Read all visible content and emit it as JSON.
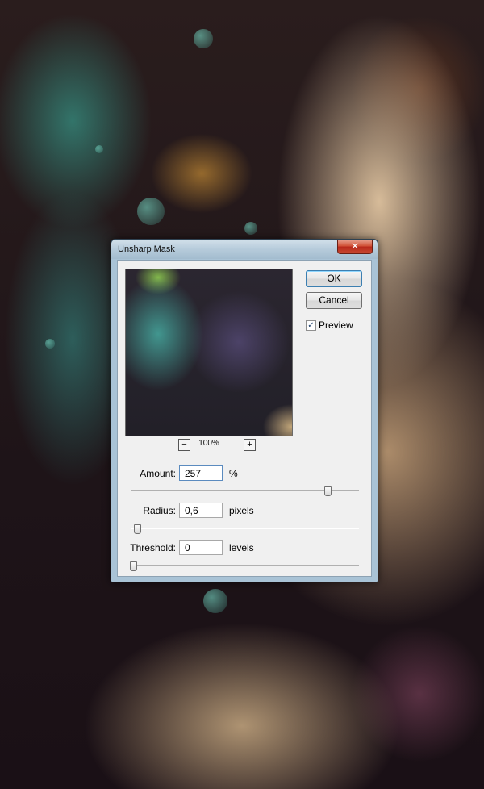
{
  "dialog": {
    "title": "Unsharp Mask",
    "close_label": "✕",
    "ok_label": "OK",
    "cancel_label": "Cancel",
    "preview_checked": true,
    "preview_check_glyph": "✓",
    "preview_label": "Preview",
    "zoom": {
      "minus_label": "−",
      "plus_label": "+",
      "level": "100%"
    },
    "params": [
      {
        "label": "Amount:",
        "value": "257",
        "unit": "%",
        "slider_fraction": 0.88
      },
      {
        "label": "Radius:",
        "value": "0,6",
        "unit": "pixels",
        "slider_fraction": 0.02
      },
      {
        "label": "Threshold:",
        "value": "0",
        "unit": "levels",
        "slider_fraction": 0.0
      }
    ]
  },
  "colors": {
    "dialog_frame": "#a9c3d6",
    "close_button": "#c64a33",
    "default_button_border": "#3c7fb1"
  },
  "icons": {
    "close": "close-icon",
    "checkbox": "checkmark-icon"
  }
}
